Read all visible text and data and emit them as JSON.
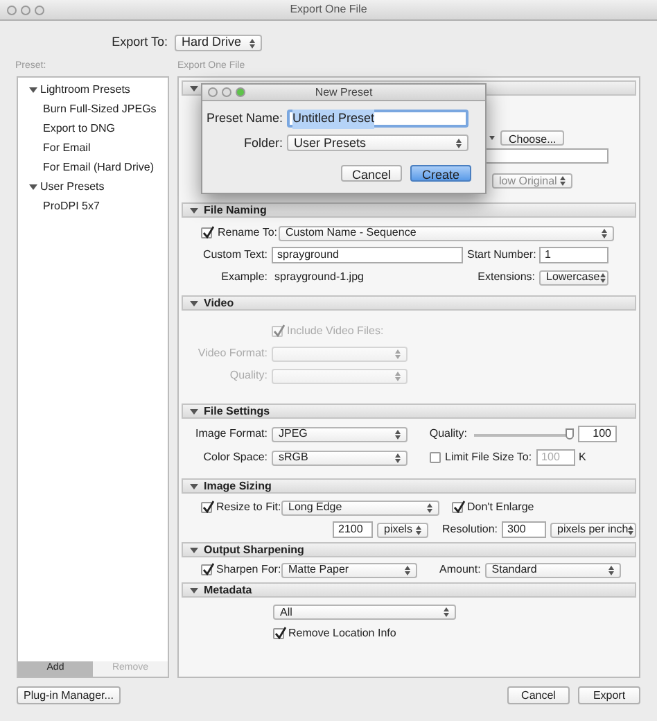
{
  "window": {
    "title": "Export One File"
  },
  "export_to": {
    "label": "Export To:",
    "value": "Hard Drive"
  },
  "preset_label": "Preset:",
  "panel_title": "Export One File",
  "presets": [
    {
      "label": "Lightroom Presets",
      "expanded": true,
      "children": [
        {
          "label": "Burn Full-Sized JPEGs"
        },
        {
          "label": "Export to DNG"
        },
        {
          "label": "For Email"
        },
        {
          "label": "For Email (Hard Drive)"
        }
      ]
    },
    {
      "label": "User Presets",
      "expanded": true,
      "children": [
        {
          "label": "ProDPI 5x7"
        }
      ]
    }
  ],
  "preset_buttons": [
    {
      "label": "Add",
      "disabled": false
    },
    {
      "label": "Remove",
      "disabled": true
    }
  ],
  "sections": [
    {
      "kind": "export_location",
      "expanded": true,
      "choose_button": "Choose...",
      "existing_files": "low Original"
    },
    {
      "kind": "file_naming",
      "title": "File Naming",
      "expanded": true,
      "rename": {
        "label": "Rename To:",
        "checked": true,
        "value": "Custom Name - Sequence"
      },
      "custom_text": {
        "label": "Custom Text:",
        "value": "sprayground"
      },
      "start_number": {
        "label": "Start Number:",
        "value": "1"
      },
      "example": {
        "label": "Example:",
        "value": "sprayground-1.jpg"
      },
      "extensions": {
        "label": "Extensions:",
        "value": "Lowercase"
      }
    },
    {
      "kind": "video",
      "title": "Video",
      "expanded": true,
      "include": {
        "label": "Include Video Files:",
        "checked": true,
        "disabled": true
      },
      "video_format": {
        "label": "Video Format:"
      },
      "quality": {
        "label": "Quality:"
      }
    },
    {
      "kind": "file_settings",
      "title": "File Settings",
      "expanded": true,
      "image_format": {
        "label": "Image Format:",
        "value": "JPEG"
      },
      "quality": {
        "label": "Quality:",
        "level": 1,
        "value": "100"
      },
      "color_space": {
        "label": "Color Space:",
        "value": "sRGB"
      },
      "limit": {
        "label": "Limit File Size To:",
        "checked": false,
        "value": "100",
        "unit": "K"
      }
    },
    {
      "kind": "image_sizing",
      "title": "Image Sizing",
      "expanded": true,
      "resize": {
        "label": "Resize to Fit:",
        "checked": true,
        "value": "Long Edge"
      },
      "dont_enlarge": {
        "label": "Don't Enlarge",
        "checked": true
      },
      "size": {
        "value": "2100",
        "unit": "pixels"
      },
      "resolution": {
        "label": "Resolution:",
        "value": "300",
        "unit": "pixels per inch"
      }
    },
    {
      "kind": "output_sharpening",
      "title": "Output Sharpening",
      "expanded": true,
      "sharpen": {
        "label": "Sharpen For:",
        "checked": true,
        "value": "Matte Paper"
      },
      "amount": {
        "label": "Amount:",
        "value": "Standard"
      }
    },
    {
      "kind": "metadata",
      "title": "Metadata",
      "expanded": true,
      "include": {
        "value": "All"
      },
      "remove_location": {
        "label": "Remove Location Info",
        "checked": true
      }
    }
  ],
  "footer": {
    "plugin_manager": "Plug-in Manager...",
    "buttons": [
      "Cancel",
      "Export"
    ]
  },
  "new_preset": {
    "title": "New Preset",
    "name": {
      "label": "Preset Name:",
      "value": "Untitled Preset"
    },
    "folder": {
      "label": "Folder:",
      "value": "User Presets"
    },
    "buttons": [
      {
        "label": "Cancel",
        "default": false
      },
      {
        "label": "Create",
        "default": true
      }
    ]
  }
}
